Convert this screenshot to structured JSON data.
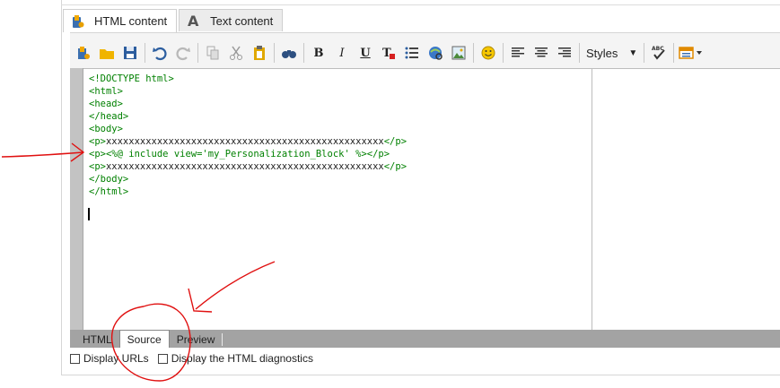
{
  "tabs": [
    {
      "label": "HTML content",
      "icon": "html-content-icon",
      "active": true
    },
    {
      "label": "Text content",
      "icon": "text-content-icon",
      "active": false
    }
  ],
  "toolbar": {
    "styles_label": "Styles",
    "bold": "B",
    "italic": "I",
    "underline": "U",
    "spell": "ABC"
  },
  "editor": {
    "lines": [
      {
        "tag_open": "<!DOCTYPE html>",
        "text": "",
        "tag_close": ""
      },
      {
        "tag_open": "<html>",
        "text": "",
        "tag_close": ""
      },
      {
        "tag_open": "<head>",
        "text": "",
        "tag_close": ""
      },
      {
        "tag_open": "</head>",
        "text": "",
        "tag_close": ""
      },
      {
        "tag_open": "<body>",
        "text": "",
        "tag_close": ""
      },
      {
        "tag_open": "<p>",
        "text": "xxxxxxxxxxxxxxxxxxxxxxxxxxxxxxxxxxxxxxxxxxxxxxxxx",
        "tag_close": "</p>"
      },
      {
        "tag_open": "<p>",
        "text": "<%@ include view='my_Personalization_Block' %>",
        "tag_close": "</p>"
      },
      {
        "tag_open": "<p>",
        "text": "xxxxxxxxxxxxxxxxxxxxxxxxxxxxxxxxxxxxxxxxxxxxxxxxx",
        "tag_close": "</p>"
      },
      {
        "tag_open": "</body>",
        "text": "",
        "tag_close": ""
      },
      {
        "tag_open": "</html>",
        "text": "",
        "tag_close": ""
      }
    ]
  },
  "bottom_tabs": [
    {
      "label": "HTML",
      "active": false
    },
    {
      "label": "Source",
      "active": true
    },
    {
      "label": "Preview",
      "active": false
    }
  ],
  "options": [
    {
      "label": "Display URLs",
      "checked": false
    },
    {
      "label": "Display the HTML diagnostics",
      "checked": false
    }
  ],
  "colors": {
    "annotation": "#e01010",
    "code_tag": "#008000",
    "gutter": "#c3c3c3",
    "bottom_bar": "#a3a3a3"
  }
}
